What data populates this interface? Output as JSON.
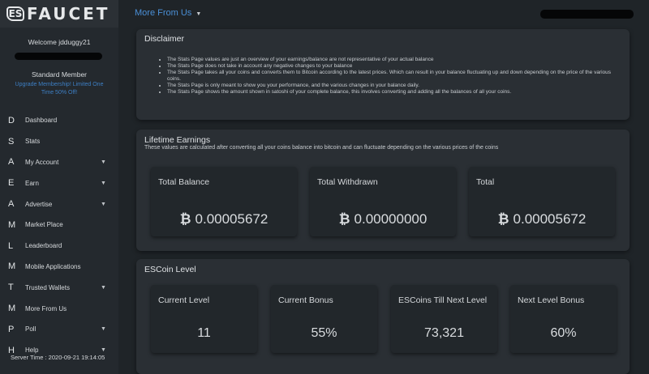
{
  "logo": {
    "mark": "ES",
    "text": "FAUCET"
  },
  "sidebar": {
    "welcome": "Welcome jdduggy21",
    "member": "Standard Member",
    "upgrade": "Upgrade Membership! Limited One Time 50% Off!",
    "items": [
      {
        "letter": "D",
        "label": "Dashboard",
        "caret": ""
      },
      {
        "letter": "S",
        "label": "Stats",
        "caret": ""
      },
      {
        "letter": "A",
        "label": "My Account",
        "caret": "▼"
      },
      {
        "letter": "E",
        "label": "Earn",
        "caret": "▼"
      },
      {
        "letter": "A",
        "label": "Advertise",
        "caret": "▼"
      },
      {
        "letter": "M",
        "label": "Market Place",
        "caret": ""
      },
      {
        "letter": "L",
        "label": "Leaderboard",
        "caret": ""
      },
      {
        "letter": "M",
        "label": "Mobile Applications",
        "caret": ""
      },
      {
        "letter": "T",
        "label": "Trusted Wallets",
        "caret": "▼"
      },
      {
        "letter": "M",
        "label": "More From Us",
        "caret": ""
      },
      {
        "letter": "P",
        "label": "Poll",
        "caret": "▼"
      },
      {
        "letter": "H",
        "label": "Help",
        "caret": "▼"
      }
    ],
    "server_time": "Server Time : 2020-09-21 19:14:05"
  },
  "topbar": {
    "more_from": "More From Us",
    "caret": "▼"
  },
  "disclaimer": {
    "title": "Disclaimer",
    "points": [
      "The Stats Page values are just an overview of your earnings/balance are not representative of your actual balance",
      "The Stats Page does not take in account any negative changes to your balance",
      "The Stats Page takes all your coins and converts them to Bitcoin according to the latest prices. Which can result in your balance fluctuating up and down depending on the price of the various coins.",
      "The Stats Page is only meant to show you your performance, and the various changes in your balance daily.",
      "The Stats Page shows the amount shown in satoshi of your complete balance, this involves converting and adding all the balances of all your coins."
    ]
  },
  "earnings": {
    "title": "Lifetime Earnings",
    "subtitle": "These values are calculated after converting all your coins balance into bitcoin and can fluctuate depending on the various prices of the coins",
    "btc_symbol": "₿",
    "total_balance": {
      "label": "Total Balance",
      "value": "0.00005672"
    },
    "total_withdrawn": {
      "label": "Total Withdrawn",
      "value": "0.00000000"
    },
    "total": {
      "label": "Total",
      "value": "0.00005672"
    }
  },
  "escoin": {
    "title": "ESCoin Level",
    "current_level": {
      "label": "Current Level",
      "value": "11"
    },
    "current_bonus": {
      "label": "Current Bonus",
      "value": "55%"
    },
    "till_next": {
      "label": "ESCoins Till Next Level",
      "value": "73,321"
    },
    "next_bonus": {
      "label": "Next Level Bonus",
      "value": "60%"
    }
  },
  "colors": {
    "link": "#4a8fd6",
    "upgrade": "#3d7fc4",
    "card": "#2a2f34",
    "sidebar": "#24292e"
  }
}
